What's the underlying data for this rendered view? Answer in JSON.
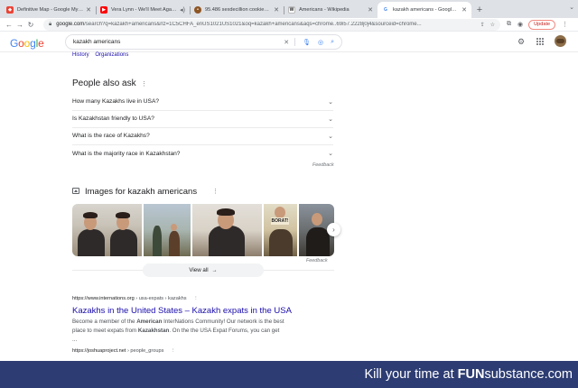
{
  "browser": {
    "tabs": [
      {
        "title": "Definitive Map - Google My Ma...",
        "favicon": "google-my-maps-icon",
        "color": "#ea4335",
        "active": false
      },
      {
        "title": "Vera Lynn - We'll Meet Again...",
        "favicon": "youtube-icon",
        "color": "#ff0000",
        "active": false
      },
      {
        "title": "95.486 sexdecillion cookies -...",
        "favicon": "cookie-icon",
        "color": "#8d5524",
        "active": false
      },
      {
        "title": "Americans - Wikipedia",
        "favicon": "wikipedia-icon",
        "color": "#ffffff",
        "active": false
      },
      {
        "title": "kazakh americans - Google Se...",
        "favicon": "google-icon",
        "color": "#4285f4",
        "active": true
      }
    ],
    "url_host": "google.com",
    "url_rest": "/search?q=kazakh+americans&rlz=1C5CHFA_enUS1021US1021&oq=kazakh+americans&aqs=chrome..69i57.2228j0j4&sourceid=chrome...",
    "update_label": "Update"
  },
  "google": {
    "logo": [
      "G",
      "o",
      "o",
      "g",
      "l",
      "e"
    ],
    "query": "kazakh americans"
  },
  "chips": [
    "History",
    "Organizations"
  ],
  "paa": {
    "title": "People also ask",
    "questions": [
      "How many Kazakhs live in USA?",
      "Is Kazakhstan friendly to USA?",
      "What is the race of Kazakhs?",
      "What is the majority race in Kazakhstan?"
    ],
    "feedback": "Feedback"
  },
  "images": {
    "title": "Images for kazakh americans",
    "borat_sign": "BORAT!",
    "feedback": "Feedback",
    "view_all": "View all"
  },
  "results": [
    {
      "cite_host": "https://www.internations.org",
      "cite_path": " › usa-expats › kazakhs",
      "title": "Kazakhs in the United States – Kazakh expats in the USA",
      "snippet_parts": [
        "Become a member of the ",
        "American",
        " InterNations Community! Our network is the best place to meet expats from ",
        "Kazakhstan",
        ". On the the USA Expat Forums, you can get ..."
      ]
    },
    {
      "cite_host": "https://joshuaproject.net",
      "cite_path": " › people_groups"
    }
  ],
  "banner": {
    "prefix": "Kill your time at ",
    "brand_bold": "FUN",
    "brand_rest": "substance.com"
  }
}
